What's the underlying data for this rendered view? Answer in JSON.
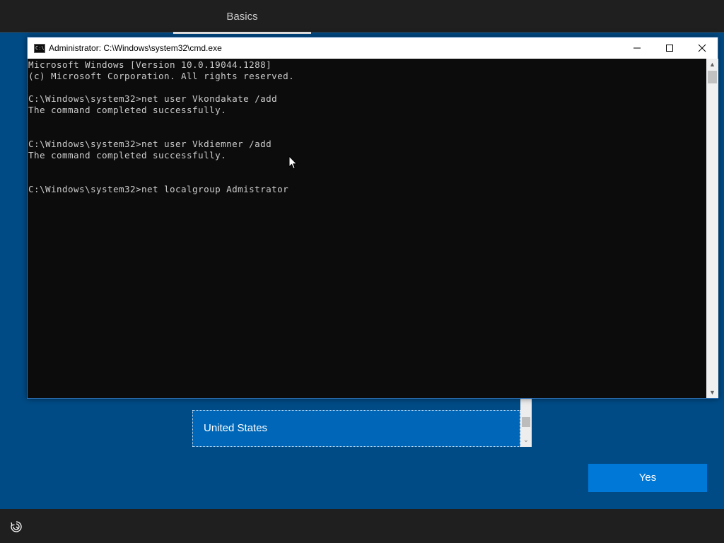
{
  "header": {
    "tab_label": "Basics"
  },
  "region_list": {
    "selected_item": "United States"
  },
  "yes_button": {
    "label": "Yes"
  },
  "cmd_window": {
    "title": "Administrator: C:\\Windows\\system32\\cmd.exe",
    "icon_text": "C:\\",
    "lines": [
      "Microsoft Windows [Version 10.0.19044.1288]",
      "(c) Microsoft Corporation. All rights reserved.",
      "",
      "C:\\Windows\\system32>net user Vkondakate /add",
      "The command completed successfully.",
      "",
      "",
      "C:\\Windows\\system32>net user Vkdiemner /add",
      "The command completed successfully.",
      "",
      "",
      "C:\\Windows\\system32>net localgroup Admistrator"
    ]
  },
  "icons": {
    "accessibility": "accessibility-icon",
    "cmd": "cmd-icon",
    "minimize": "minimize-icon",
    "maximize": "maximize-icon",
    "close": "close-icon",
    "cursor": "mouse-pointer-icon"
  },
  "colors": {
    "background": "#004b86",
    "accent": "#0078d7",
    "selection": "#0067b8",
    "console_bg": "#0c0c0c",
    "console_text": "#cccccc"
  }
}
